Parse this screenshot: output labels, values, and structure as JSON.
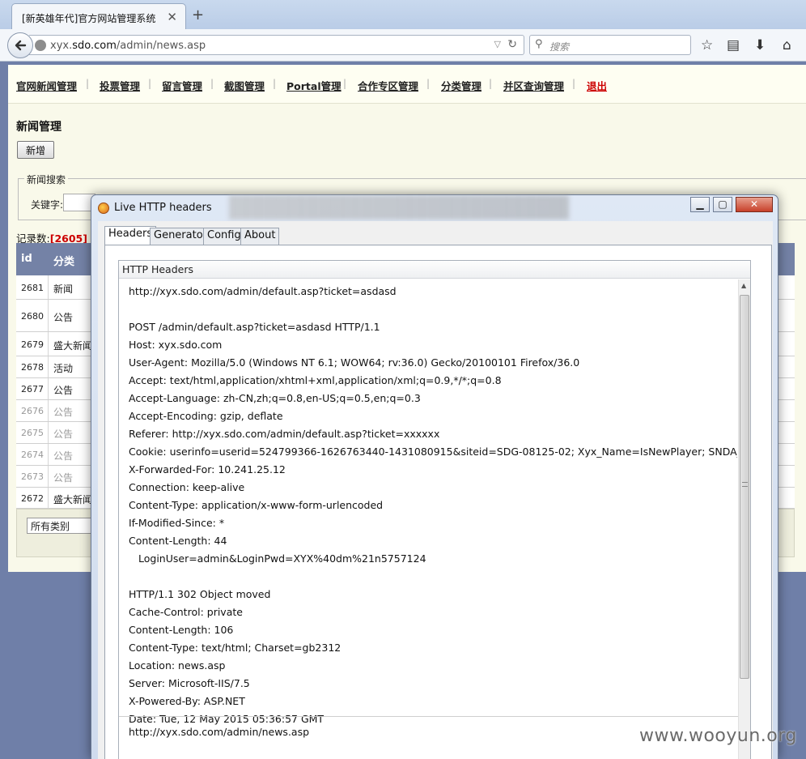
{
  "browser": {
    "tab_title": "[新英雄年代]官方网站管理系统",
    "tab_close": "✕",
    "new_tab": "+",
    "url_prefix": "xyx.",
    "url_host": "sdo.com",
    "url_path": "/admin/news.asp",
    "search_placeholder": "搜索"
  },
  "menu": {
    "items": [
      "官网新闻管理",
      "投票管理",
      "留言管理",
      "截图管理",
      "Portal管理",
      "合作专区管理",
      "分类管理",
      "并区查询管理",
      "退出"
    ]
  },
  "page": {
    "section_title": "新闻管理",
    "add_button": "新增",
    "search_legend": "新闻搜索",
    "keyword_label": "关键字:",
    "count_label": "记录数:",
    "count_open": "[",
    "count_value": "2605",
    "count_close": "]",
    "columns": [
      "id",
      "分类"
    ],
    "rows": [
      {
        "id": "2681",
        "cat": "新闻"
      },
      {
        "id": "2680",
        "cat": "公告"
      },
      {
        "id": "2679",
        "cat": "盛大新闻"
      },
      {
        "id": "2678",
        "cat": "活动"
      },
      {
        "id": "2677",
        "cat": "公告"
      },
      {
        "id": "2676",
        "cat": "公告"
      },
      {
        "id": "2675",
        "cat": "公告"
      },
      {
        "id": "2674",
        "cat": "公告"
      },
      {
        "id": "2673",
        "cat": "公告"
      },
      {
        "id": "2672",
        "cat": "盛大新闻"
      }
    ],
    "category_select": "所有类别"
  },
  "live_headers": {
    "title": "Live HTTP headers",
    "tabs": [
      "Headers",
      "Generator",
      "Config",
      "About"
    ],
    "box_title": "HTTP Headers",
    "lines": [
      "http://xyx.sdo.com/admin/default.asp?ticket=asdasd",
      "",
      "POST /admin/default.asp?ticket=asdasd HTTP/1.1",
      "Host: xyx.sdo.com",
      "User-Agent: Mozilla/5.0 (Windows NT 6.1; WOW64; rv:36.0) Gecko/20100101 Firefox/36.0",
      "Accept: text/html,application/xhtml+xml,application/xml;q=0.9,*/*;q=0.8",
      "Accept-Language: zh-CN,zh;q=0.8,en-US;q=0.5,en;q=0.3",
      "Accept-Encoding: gzip, deflate",
      "Referer: http://xyx.sdo.com/admin/default.asp?ticket=xxxxxx",
      "Cookie: userinfo=userid=524799366-1626763440-1431080915&siteid=SDG-08125-02; Xyx_Name=IsNewPlayer; SNDA_ADRefer...",
      "X-Forwarded-For: 10.241.25.12",
      "Connection: keep-alive",
      "Content-Type: application/x-www-form-urlencoded",
      "If-Modified-Since: *",
      "Content-Length: 44",
      "LoginUser=admin&LoginPwd=XYX%40dm%21n5757124",
      "",
      "HTTP/1.1 302 Object moved",
      "Cache-Control: private",
      "Content-Length: 106",
      "Content-Type: text/html; Charset=gb2312",
      "Location: news.asp",
      "Server: Microsoft-IIS/7.5",
      "X-Powered-By: ASP.NET",
      "Date: Tue, 12 May 2015 05:36:57 GMT"
    ],
    "next_request": "http://xyx.sdo.com/admin/news.asp"
  },
  "watermark": "www.wooyun.org"
}
